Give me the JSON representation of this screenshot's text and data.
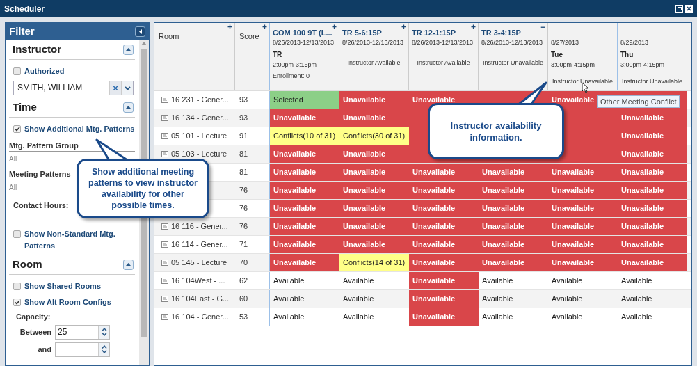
{
  "window": {
    "title": "Scheduler"
  },
  "filter": {
    "title": "Filter",
    "sections": [
      {
        "title": "Instructor",
        "items": [
          {
            "kind": "checkbox",
            "label": "Authorized",
            "checked": false
          },
          {
            "kind": "combo",
            "value": "SMITH, WILLIAM",
            "clear": "×"
          }
        ]
      },
      {
        "title": "Time",
        "items": [
          {
            "kind": "checkbox",
            "label": "Show Additional Mtg. Patterns",
            "checked": true
          },
          {
            "kind": "subhead",
            "label": "Mtg. Pattern Group"
          },
          {
            "kind": "value",
            "label": "All"
          },
          {
            "kind": "subhead",
            "label": "Meeting Patterns"
          },
          {
            "kind": "value",
            "label": "All"
          },
          {
            "kind": "label",
            "label": "Contact Hours:"
          },
          {
            "kind": "checkbox",
            "label": "Show Non-Standard Mtg. Patterns",
            "checked": false
          }
        ]
      },
      {
        "title": "Room",
        "items": [
          {
            "kind": "checkbox",
            "label": "Show Shared Rooms",
            "checked": false
          },
          {
            "kind": "checkbox",
            "label": "Show Alt Room Configs",
            "checked": true
          },
          {
            "kind": "fieldset",
            "label": "Capacity:"
          },
          {
            "kind": "spinner",
            "label": "Between",
            "value": "25"
          },
          {
            "kind": "spinner",
            "label": "and"
          }
        ]
      }
    ]
  },
  "grid": {
    "fixed_columns": [
      {
        "label": "Room",
        "toggle": "+"
      },
      {
        "label": "Score",
        "toggle": "+"
      }
    ],
    "columns": [
      {
        "title": "COM 100 9T (L...",
        "dates": "8/26/2013-12/13/2013",
        "day": "TR",
        "time": "2:00pm-3:15pm",
        "extra": "Enrollment: 0",
        "toggle": "+"
      },
      {
        "title": "TR 5-6:15P",
        "dates": "8/26/2013-12/13/2013",
        "note": "Instructor Available",
        "toggle": "+"
      },
      {
        "title": "TR 12-1:15P",
        "dates": "8/26/2013-12/13/2013",
        "note": "Instructor Available",
        "toggle": "+"
      },
      {
        "title": "TR 3-4:15P",
        "dates": "8/26/2013-12/13/2013",
        "note": "Instructor Unavailable",
        "toggle": "−"
      },
      {
        "dates": "8/27/2013",
        "day": "Tue",
        "time": "3:00pm-4:15pm",
        "footer": "Instructor Unavailable"
      },
      {
        "dates": "8/29/2013",
        "day": "Thu",
        "time": "3:00pm-4:15pm",
        "footer": "Instructor Unavailable"
      }
    ],
    "rows": [
      {
        "room": "16 231 - Gener...",
        "score": "93",
        "cells": [
          {
            "kind": "selected",
            "text": "Selected"
          },
          {
            "kind": "unavailable",
            "text": "Unavailable"
          },
          {
            "kind": "unavailable",
            "text": "Unavailable"
          },
          {
            "kind": "unavailable"
          },
          {
            "kind": "unavailable",
            "text": "Unavailable"
          },
          {
            "kind": "unavailable"
          }
        ]
      },
      {
        "room": "16 134 - Gener...",
        "score": "93",
        "cells": [
          {
            "kind": "unavailable",
            "text": "Unavailable"
          },
          {
            "kind": "unavailable",
            "text": "Unavailable"
          },
          {
            "kind": "unavailable"
          },
          null,
          {
            "kind": "unavailable"
          },
          {
            "kind": "unavailable",
            "text": "Unavailable"
          }
        ]
      },
      {
        "room": "05 101 - Lecture",
        "score": "91",
        "cells": [
          {
            "kind": "conflict",
            "text": "Conflicts(10 of 31)"
          },
          {
            "kind": "conflict",
            "text": "Conflicts(30 of 31)"
          },
          {
            "kind": "unavailable"
          },
          null,
          {
            "kind": "unavailable"
          },
          {
            "kind": "unavailable",
            "text": "Unavailable"
          }
        ]
      },
      {
        "room": "05 103 - Lecture",
        "score": "81",
        "cells": [
          {
            "kind": "unavailable",
            "text": "Unavailable"
          },
          {
            "kind": "unavailable",
            "text": "Unavailable"
          },
          {
            "kind": "unavailable"
          },
          {
            "kind": "unavailable"
          },
          {
            "kind": "unavailable"
          },
          {
            "kind": "unavailable",
            "text": "Unavailable"
          }
        ]
      },
      {
        "score": "81",
        "cells": [
          {
            "kind": "unavailable",
            "text": "Unavailable"
          },
          {
            "kind": "unavailable",
            "text": "Unavailable"
          },
          {
            "kind": "unavailable",
            "text": "Unavailable"
          },
          {
            "kind": "unavailable",
            "text": "Unavailable"
          },
          {
            "kind": "unavailable",
            "text": "Unavailable"
          },
          {
            "kind": "unavailable",
            "text": "Unavailable"
          }
        ]
      },
      {
        "score": "76",
        "cells": [
          {
            "kind": "unavailable",
            "text": "Unavailable"
          },
          {
            "kind": "unavailable",
            "text": "Unavailable"
          },
          {
            "kind": "unavailable",
            "text": "Unavailable"
          },
          {
            "kind": "unavailable",
            "text": "Unavailable"
          },
          {
            "kind": "unavailable",
            "text": "Unavailable"
          },
          {
            "kind": "unavailable",
            "text": "Unavailable"
          }
        ]
      },
      {
        "score": "76",
        "cells": [
          {
            "kind": "unavailable",
            "text": "Unavailable"
          },
          {
            "kind": "unavailable",
            "text": "Unavailable"
          },
          {
            "kind": "unavailable",
            "text": "Unavailable"
          },
          {
            "kind": "unavailable",
            "text": "Unavailable"
          },
          {
            "kind": "unavailable",
            "text": "Unavailable"
          },
          {
            "kind": "unavailable",
            "text": "Unavailable"
          }
        ]
      },
      {
        "room": "16 116 - Gener...",
        "score": "76",
        "cells": [
          {
            "kind": "unavailable",
            "text": "Unavailable"
          },
          {
            "kind": "unavailable",
            "text": "Unavailable"
          },
          {
            "kind": "unavailable",
            "text": "Unavailable"
          },
          {
            "kind": "unavailable",
            "text": "Unavailable"
          },
          {
            "kind": "unavailable",
            "text": "Unavailable"
          },
          {
            "kind": "unavailable",
            "text": "Unavailable"
          }
        ]
      },
      {
        "room": "16 114 - Gener...",
        "score": "71",
        "cells": [
          {
            "kind": "unavailable",
            "text": "Unavailable"
          },
          {
            "kind": "unavailable",
            "text": "Unavailable"
          },
          {
            "kind": "unavailable",
            "text": "Unavailable"
          },
          {
            "kind": "unavailable",
            "text": "Unavailable"
          },
          {
            "kind": "unavailable",
            "text": "Unavailable"
          },
          {
            "kind": "unavailable",
            "text": "Unavailable"
          }
        ]
      },
      {
        "room": "05 145 - Lecture",
        "score": "70",
        "cells": [
          {
            "kind": "unavailable",
            "text": "Unavailable"
          },
          {
            "kind": "conflict",
            "text": "Conflicts(14 of 31)"
          },
          {
            "kind": "unavailable",
            "text": "Unavailable"
          },
          {
            "kind": "unavailable",
            "text": "Unavailable"
          },
          {
            "kind": "unavailable",
            "text": "Unavailable"
          },
          {
            "kind": "unavailable",
            "text": "Unavailable"
          }
        ]
      },
      {
        "room": "16 104West - ...",
        "score": "62",
        "cells": [
          {
            "kind": "available",
            "text": "Available"
          },
          {
            "kind": "available",
            "text": "Available"
          },
          {
            "kind": "unavailable",
            "text": "Unavailable"
          },
          {
            "kind": "available",
            "text": "Available"
          },
          {
            "kind": "available",
            "text": "Available"
          },
          {
            "kind": "available",
            "text": "Available"
          }
        ]
      },
      {
        "room": "16 104East - G...",
        "score": "60",
        "cells": [
          {
            "kind": "available",
            "text": "Available"
          },
          {
            "kind": "available",
            "text": "Available"
          },
          {
            "kind": "unavailable",
            "text": "Unavailable"
          },
          {
            "kind": "available",
            "text": "Available"
          },
          {
            "kind": "available",
            "text": "Available"
          },
          {
            "kind": "available",
            "text": "Available"
          }
        ]
      },
      {
        "room": "16 104 - Gener...",
        "score": "53",
        "cells": [
          {
            "kind": "available",
            "text": "Available"
          },
          {
            "kind": "available",
            "text": "Available"
          },
          {
            "kind": "unavailable",
            "text": "Unavailable"
          },
          {
            "kind": "available",
            "text": "Available"
          },
          {
            "kind": "available",
            "text": "Available"
          },
          {
            "kind": "available",
            "text": "Available"
          }
        ]
      }
    ]
  },
  "tooltip": "Other Meeting Conflict",
  "callouts": [
    "Show additional meeting patterns to view instructor availability for other possible times.",
    "Instructor availability information."
  ]
}
